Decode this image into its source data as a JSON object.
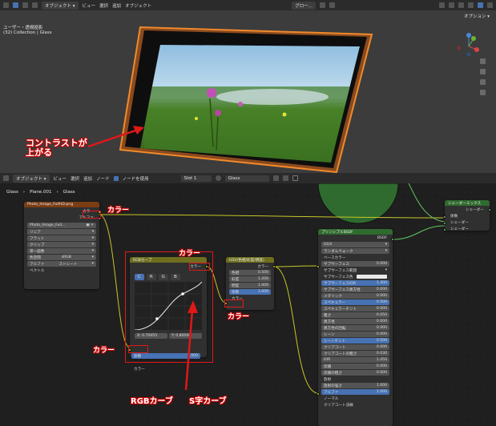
{
  "top_header": {
    "mode_label": "オブジェクト ▾",
    "menus": [
      "ビュー",
      "選択",
      "追加",
      "オブジェクト"
    ],
    "transform_label": "グロー...",
    "options_label": "オプション ▾"
  },
  "viewport": {
    "view_name": "ユーザー・透視投影",
    "collection": "(32) Collection | Glass",
    "annotation": "コントラストが\n上がる"
  },
  "node_header": {
    "mode_label": "オブジェクト ▾",
    "menus": [
      "ビュー",
      "選択",
      "追加",
      "ノード"
    ],
    "use_nodes_label": "ノードを使用",
    "slot_label": "Slot 1",
    "material_label": "Glass"
  },
  "breadcrumb": [
    "Glass",
    "Plane.001",
    "Glass"
  ],
  "nodes": {
    "image": {
      "title": "Photo_Image_FullHD.png",
      "out_color": "カラー",
      "out_alpha": "アルファ",
      "image_name": "Photo_Image_Full...",
      "dropdowns": [
        "リニア",
        "フラット",
        "クリップ",
        "単一画像"
      ],
      "color_space_label": "色空間",
      "color_space_value": "sRGB",
      "alpha_label": "アルファ",
      "alpha_value": "ストレート",
      "vector": "ベクトル"
    },
    "rgb_curves": {
      "title": "RGBカーブ",
      "out_color": "カラー",
      "channels": [
        "C",
        "R",
        "G",
        "B"
      ],
      "coord_x": "X: 0.70455",
      "coord_y": "Y: 0.80000",
      "factor_label": "係数",
      "factor_value": "1.000",
      "in_color": "カラー"
    },
    "hsv": {
      "title": "HSV(色相/彩度/明度)",
      "out_color": "カラー",
      "rows": [
        {
          "label": "色相",
          "value": "0.500"
        },
        {
          "label": "彩度",
          "value": "1.200"
        },
        {
          "label": "明度",
          "value": "1.000"
        },
        {
          "label": "係数",
          "value": "1.000"
        }
      ],
      "in_color": "カラー"
    },
    "principled": {
      "title": "プリンシプルBSDF",
      "out": "BSDF",
      "distribution": "GGX",
      "subsurface_method": "ランダムウォーク",
      "rows": [
        {
          "label": "ベースカラー",
          "value": ""
        },
        {
          "label": "サブサーフェス",
          "value": "0.000"
        },
        {
          "label": "サブサーフェス範囲",
          "value": ""
        },
        {
          "label": "サブサーフェス色",
          "value": ""
        },
        {
          "label": "サブサーフェスIOR",
          "value": "1.400"
        },
        {
          "label": "サブサーフェス異方性",
          "value": "0.000"
        },
        {
          "label": "メタリック",
          "value": "0.000"
        },
        {
          "label": "スペキュラー",
          "value": "0.500"
        },
        {
          "label": "スペキュラーチント",
          "value": "0.000"
        },
        {
          "label": "粗さ",
          "value": "0.050"
        },
        {
          "label": "異方性",
          "value": "0.000"
        },
        {
          "label": "異方性の回転",
          "value": "0.000"
        },
        {
          "label": "シーン",
          "value": "0.000"
        },
        {
          "label": "シーンチント",
          "value": "0.500"
        },
        {
          "label": "クリアコート",
          "value": "0.000"
        },
        {
          "label": "クリアコートの粗さ",
          "value": "0.030"
        },
        {
          "label": "IOR",
          "value": "1.450"
        },
        {
          "label": "伝播",
          "value": "0.000"
        },
        {
          "label": "伝播の粗さ",
          "value": "0.000"
        },
        {
          "label": "放射",
          "value": ""
        },
        {
          "label": "放射の強さ",
          "value": "1.000"
        },
        {
          "label": "アルファ",
          "value": "1.000"
        },
        {
          "label": "ノーマル",
          "value": ""
        },
        {
          "label": "クリアコート法線",
          "value": ""
        }
      ]
    },
    "mix": {
      "title": "シェーダーミックス",
      "out": "シェーダー",
      "rows": [
        "係数",
        "シェーダー",
        "シェーダー"
      ]
    }
  },
  "annotations": {
    "image_color": "カラー",
    "curve_out_color": "カラー",
    "curve_in_color": "カラー",
    "hsv_color": "カラー",
    "rgb_curve": "RGBカーブ",
    "s_curve": "S字カーブ"
  },
  "colors": {
    "accent_red": "#e01818",
    "node_image_header": "#7a3d14",
    "node_color_header": "#6e6e1e",
    "node_shader_header": "#2f6b2f",
    "selected_outline": "#e89b3c"
  }
}
